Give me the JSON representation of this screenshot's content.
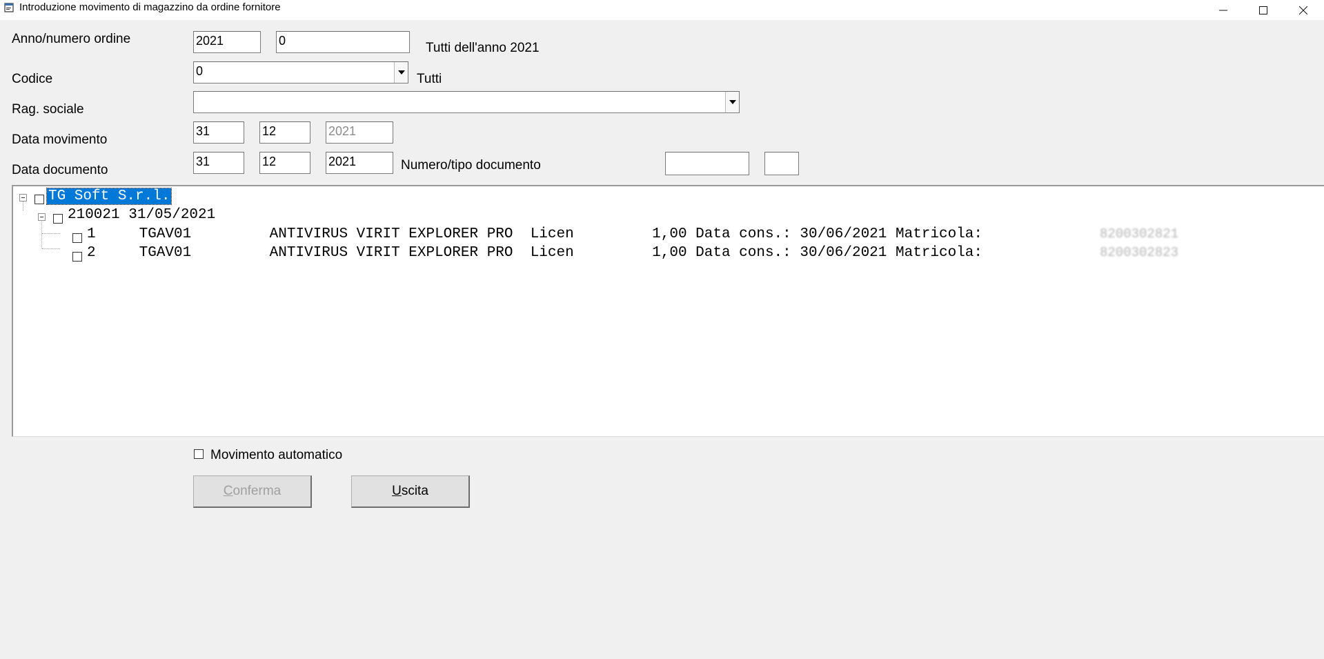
{
  "window": {
    "title": "Introduzione movimento di magazzino da ordine fornitore",
    "app_icon": "document-window-icon",
    "controls": {
      "minimize": "—",
      "maximize": "☐",
      "close": "✕"
    }
  },
  "form": {
    "anno_label": "Anno/numero ordine",
    "anno_value": "2021",
    "numero_value": "0",
    "anno_hint": "Tutti dell'anno 2021",
    "codice_label": "Codice",
    "codice_value": "0",
    "codice_hint": "Tutti",
    "rag_label": "Rag. sociale",
    "rag_value": "",
    "data_mov_label": "Data movimento",
    "data_mov_day": "31",
    "data_mov_month": "12",
    "data_mov_year": "2021",
    "data_doc_label": "Data documento",
    "data_doc_day": "31",
    "data_doc_month": "12",
    "data_doc_year": "2021",
    "num_tipo_label": "Numero/tipo documento",
    "num_doc_value": "",
    "tipo_doc_value": ""
  },
  "tree": {
    "root": "TG Soft S.r.l.",
    "order": "210021 31/05/2021",
    "items": [
      {
        "line": "1     TGAV01         ANTIVIRUS VIRIT EXPLORER PRO  Licen         1,00 Data cons.: 30/06/2021 Matricola:",
        "matricola": "8200302821"
      },
      {
        "line": "2     TGAV01         ANTIVIRUS VIRIT EXPLORER PRO  Licen         1,00 Data cons.: 30/06/2021 Matricola:",
        "matricola": "8200302823"
      }
    ]
  },
  "options": {
    "auto_label": "Movimento automatico",
    "auto_checked": false
  },
  "buttons": {
    "confirm_first": "C",
    "confirm_rest": "onferma",
    "exit_first": "U",
    "exit_rest": "scita"
  }
}
